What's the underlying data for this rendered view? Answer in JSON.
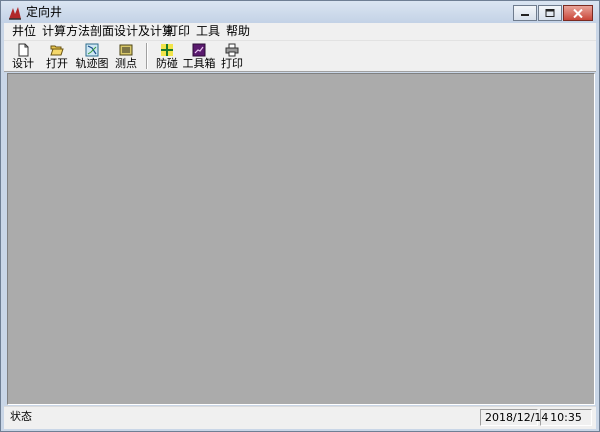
{
  "window": {
    "title": "定向井"
  },
  "menu": {
    "items": [
      "井位",
      "计算方法",
      "剖面设计及计算",
      "打印",
      "工具",
      "帮助"
    ]
  },
  "toolbar": {
    "buttons": [
      {
        "label": "设计",
        "icon": "new-document-icon"
      },
      {
        "label": "打开",
        "icon": "open-folder-icon"
      },
      {
        "label": "轨迹图",
        "icon": "trajectory-chart-icon"
      },
      {
        "label": "测点",
        "icon": "survey-point-icon"
      },
      {
        "label": "防碰",
        "icon": "anti-collision-icon"
      },
      {
        "label": "工具箱",
        "icon": "toolbox-icon"
      },
      {
        "label": "打印",
        "icon": "printer-icon"
      }
    ]
  },
  "status": {
    "text": "状态",
    "date": "2018/12/14",
    "time": "10:35"
  }
}
